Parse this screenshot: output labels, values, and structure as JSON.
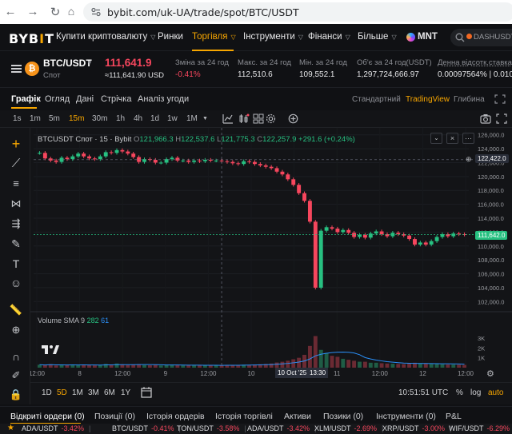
{
  "browser": {
    "url": "bybit.com/uk-UA/trade/spot/BTC/USDT"
  },
  "header": {
    "logo": "BYBIT",
    "nav": [
      {
        "label": "Купити криптовалюту",
        "caret": true
      },
      {
        "label": "Ринки",
        "caret": false
      },
      {
        "label": "Торгівля",
        "caret": true,
        "active": true
      },
      {
        "label": "Інструменти",
        "caret": true
      },
      {
        "label": "Фінанси",
        "caret": true
      },
      {
        "label": "Більше",
        "caret": true
      }
    ],
    "promo_label": "MNT",
    "search_value": "DASHUSDT"
  },
  "ticker": {
    "symbol": "BTC/USDT",
    "market": "Спот",
    "last_price": "111,641.9",
    "fiat_price": "≈111,641.90 USD",
    "stats": [
      {
        "label": "Зміна за 24 год",
        "value": "-0.41%"
      },
      {
        "label": "Макс. за 24 год",
        "value": "112,510.6"
      },
      {
        "label": "Мін. за 24 год",
        "value": "109,552.1"
      },
      {
        "label": "Об'є за 24 год(USDT)",
        "value": "1,297,724,666.97"
      },
      {
        "label": "Денна відсотк.ставка",
        "value": "0.00097564% | 0.010"
      }
    ]
  },
  "chart_tabs": {
    "tabs": [
      "Графік",
      "Огляд",
      "Дані",
      "Стрічка",
      "Аналіз угоди"
    ],
    "views": [
      "Стандартний",
      "TradingView",
      "Глибина"
    ]
  },
  "toolbar": {
    "intervals": [
      "1s",
      "1m",
      "5m",
      "15m",
      "30m",
      "1h",
      "4h",
      "1d",
      "1w",
      "1M"
    ],
    "selected_interval": "15m"
  },
  "chart": {
    "legend_title": "BTCUSDT Спот · 15 · Bybit",
    "legend_o": "O",
    "legend_o_val": "121,966.3",
    "legend_h": "H",
    "legend_h_val": "122,537.6",
    "legend_l": "L",
    "legend_l_val": "121,775.3",
    "legend_c": "C",
    "legend_c_val": "122,257.9",
    "legend_change": "+291.6 (+0.24%)",
    "volume_label": "Volume SMA 9",
    "volume_val1": "282",
    "volume_val2": "61",
    "crosshair_price": "122,422.0",
    "last_price_tag": "111,642.0",
    "crosshair_date": "10 Oct '25",
    "crosshair_time": "13:30",
    "tv_logo": "TV",
    "colors": {
      "up": "#27c081",
      "down": "#f6465d",
      "accent": "#f7a600"
    }
  },
  "chart_data": {
    "type": "line",
    "x_ticks": [
      "12:00",
      "8",
      "12:00",
      "9",
      "12:00",
      "10",
      "12:00",
      "11",
      "12:00",
      "12",
      "12:00"
    ],
    "y_ticks": [
      "126,000.0",
      "124,000.0",
      "122,000.0",
      "120,000.0",
      "118,000.0",
      "116,000.0",
      "114,000.0",
      "112,000.0",
      "110,000.0",
      "108,000.0",
      "106,000.0",
      "104,000.0",
      "102,000.0"
    ],
    "ylim": [
      101000,
      127000
    ],
    "volume_ticks": [
      "3K",
      "2K",
      "1K"
    ],
    "series": [
      {
        "values": [
          123400,
          122600,
          122300,
          122100,
          122700,
          122500,
          122900,
          123300,
          122900,
          122600,
          122500,
          122900,
          123500,
          123400,
          123800,
          123600,
          123300,
          122800,
          122100,
          122500,
          122400,
          122000,
          122000,
          122500,
          122700,
          122300,
          122300,
          122100,
          122300,
          122200,
          122400,
          122300,
          122300,
          122200,
          122100,
          121900,
          121800,
          122200,
          122100,
          121800,
          121600,
          121400,
          121200,
          120700,
          120300,
          119600,
          118800,
          117600,
          116500,
          113500,
          104000,
          112200,
          112700,
          112500,
          112000,
          112300,
          111900,
          111300,
          111600,
          111200,
          111800,
          112100,
          111700,
          111400,
          111900,
          111700,
          111500,
          111000,
          110200,
          110500,
          110200,
          110700,
          111300,
          111700,
          111400,
          111800,
          111700,
          111642
        ]
      }
    ],
    "volume": [
      300,
      250,
      350,
      220,
      280,
      260,
      300,
      240,
      320,
      260,
      230,
      250,
      380,
      300,
      420,
      330,
      260,
      300,
      350,
      260,
      240,
      280,
      220,
      260,
      300,
      240,
      230,
      250,
      230,
      240,
      220,
      230,
      240,
      250,
      260,
      270,
      280,
      300,
      280,
      320,
      350,
      380,
      420,
      520,
      600,
      700,
      850,
      1000,
      1300,
      2200,
      3200,
      1800,
      1500,
      1200,
      1100,
      900,
      800,
      700,
      600,
      600,
      500,
      500,
      450,
      420,
      400,
      380,
      360,
      400,
      500,
      450,
      420,
      380,
      360,
      340,
      320,
      310,
      300,
      280
    ]
  },
  "range_bar": {
    "ranges": [
      "1D",
      "5D",
      "1M",
      "3M",
      "6M",
      "1Y"
    ],
    "selected": "5D",
    "clock": "10:51:51 UTC",
    "percent": "%",
    "log": "log",
    "auto": "auto"
  },
  "bottom_tabs": [
    "Відкриті ордери (0)",
    "Позиції (0)",
    "Історія ордерів",
    "Історія торгівлі",
    "Активи",
    "Позики (0)",
    "Інструменти (0)",
    "P&L"
  ],
  "marquee": [
    {
      "pair": "ADA/USDT",
      "change": "-3.42%"
    },
    {
      "pair": "BTC/USDT",
      "change": "-0.41%"
    },
    {
      "pair": "TON/USDT",
      "change": "-3.58%"
    },
    {
      "pair": "ADA/USDT",
      "change": "-3.42%"
    },
    {
      "pair": "XLM/USDT",
      "change": "-2.69%"
    },
    {
      "pair": "XRP/USDT",
      "change": "-3.00%"
    },
    {
      "pair": "WIF/USDT",
      "change": "-6.29%"
    }
  ]
}
